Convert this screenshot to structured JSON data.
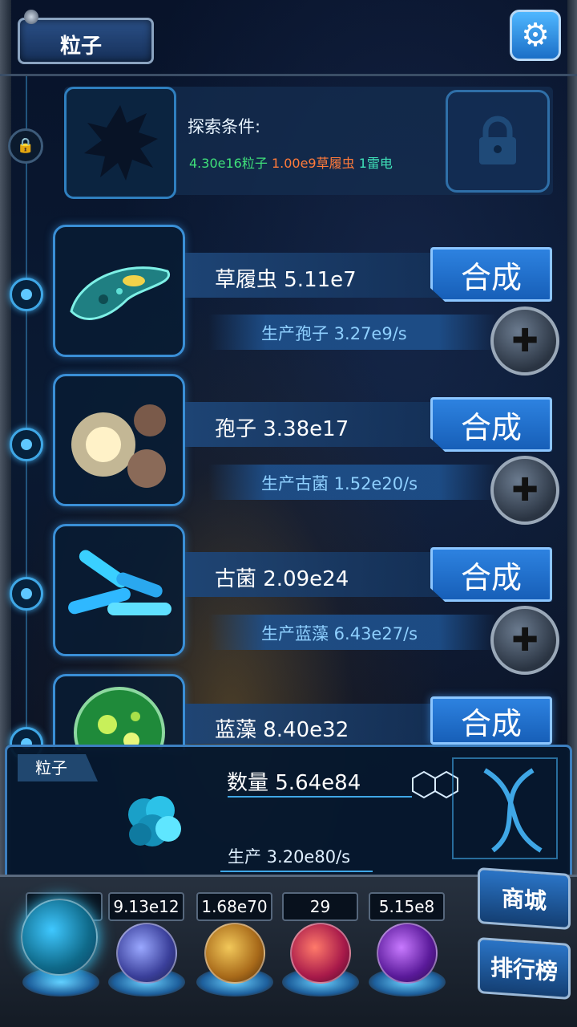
{
  "header": {
    "title": "粒子"
  },
  "explore": {
    "label": "探索条件:",
    "req_particles": "4.30e16粒子",
    "req_paramecium": "1.00e9草履虫",
    "req_thunder": "1雷电"
  },
  "organisms": [
    {
      "name": "草履虫 5.11e7",
      "production": "生产孢子 3.27e9/s",
      "synth_label": "合成"
    },
    {
      "name": "孢子 3.38e17",
      "production": "生产古菌 1.52e20/s",
      "synth_label": "合成"
    },
    {
      "name": "古菌 2.09e24",
      "production": "生产蓝藻 6.43e27/s",
      "synth_label": "合成"
    },
    {
      "name": "蓝藻 8.40e32",
      "production": "",
      "synth_label": "合成"
    }
  ],
  "panel": {
    "tag": "粒子",
    "count": "数量 5.64e84",
    "production": "生产 3.20e80/s"
  },
  "tabs": [
    {
      "value": "4",
      "orb": "particle-orb"
    },
    {
      "value": "9.13e12",
      "orb": "lightning-orb"
    },
    {
      "value": "1.68e70",
      "orb": "galaxy-orb"
    },
    {
      "value": "29",
      "orb": "brain-orb"
    },
    {
      "value": "5.15e8",
      "orb": "vortex-orb"
    }
  ],
  "side_buttons": {
    "shop": "商城",
    "ranking": "排行榜"
  },
  "colors": {
    "accent": "#3fa7e6",
    "req_green": "#3fe07a",
    "req_orange": "#ff7a3a",
    "req_teal": "#3fe0b8"
  }
}
